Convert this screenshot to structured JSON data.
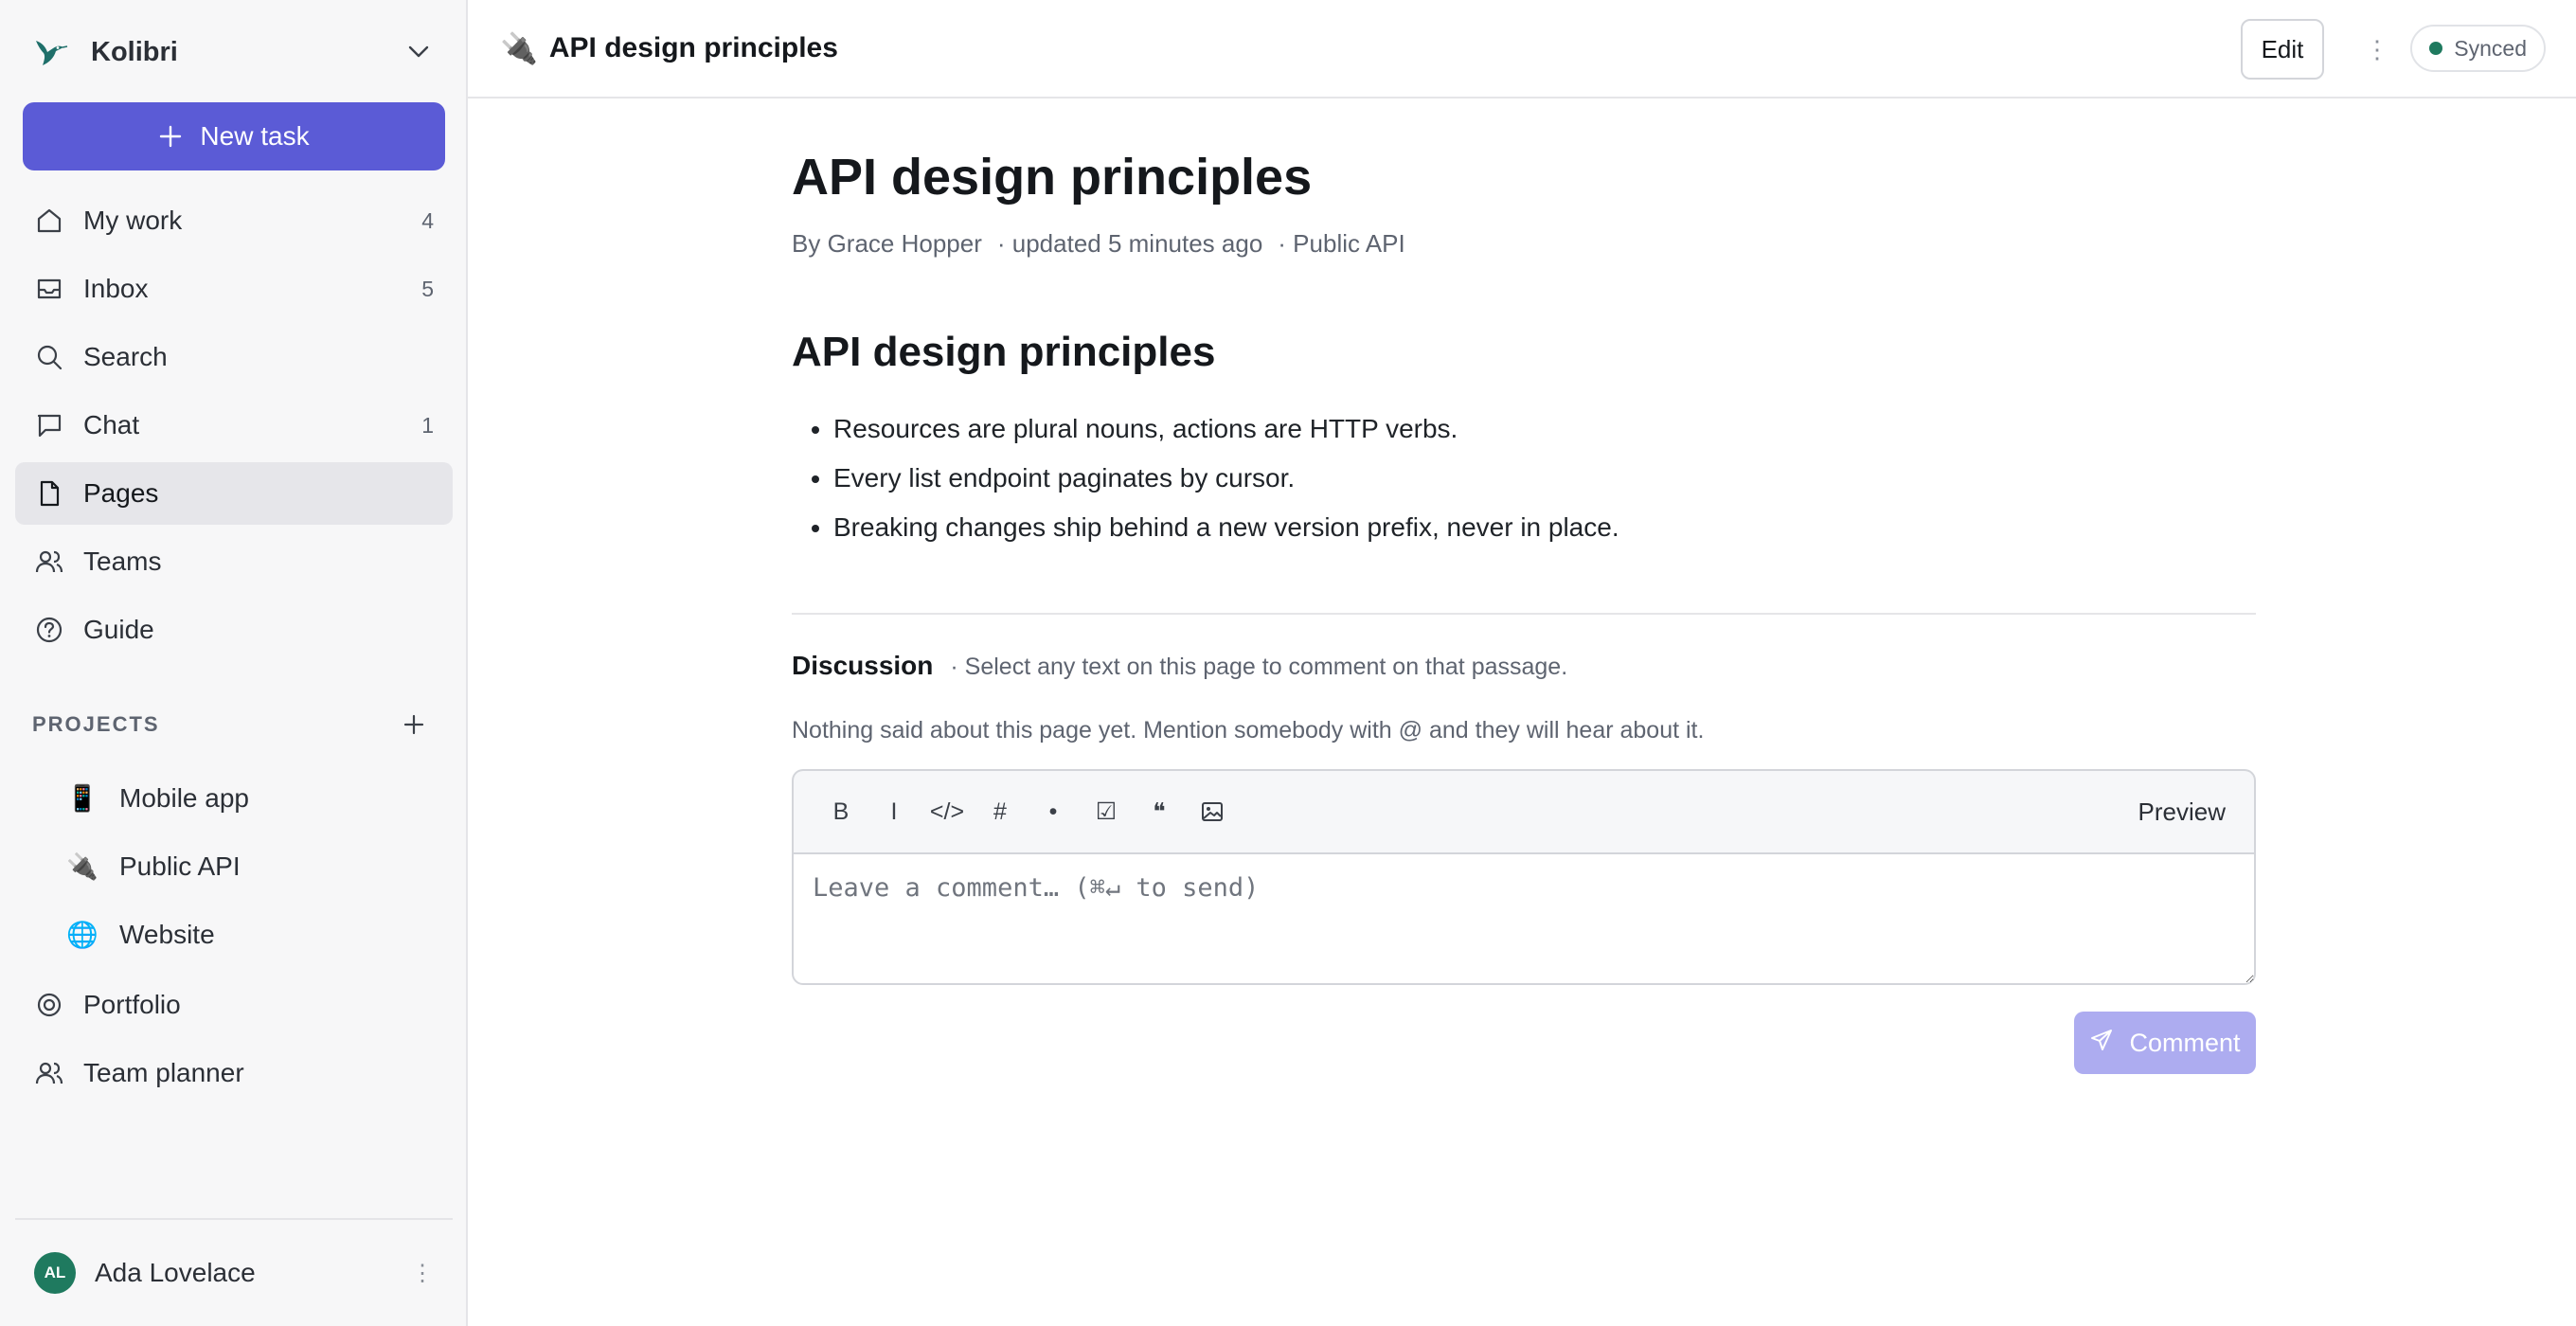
{
  "workspace": {
    "name": "Kolibri",
    "logo_icon": "hummingbird-icon"
  },
  "new_task_label": "New task",
  "nav": [
    {
      "label": "My work",
      "count": "4",
      "icon": "home-icon"
    },
    {
      "label": "Inbox",
      "count": "5",
      "icon": "inbox-icon"
    },
    {
      "label": "Search",
      "count": "",
      "icon": "search-icon"
    },
    {
      "label": "Chat",
      "count": "1",
      "icon": "chat-icon"
    },
    {
      "label": "Pages",
      "count": "",
      "icon": "page-icon",
      "active": true
    },
    {
      "label": "Teams",
      "count": "",
      "icon": "users-icon"
    },
    {
      "label": "Guide",
      "count": "",
      "icon": "help-icon"
    }
  ],
  "projects": {
    "heading": "PROJECTS",
    "items": [
      {
        "emoji": "📱",
        "label": "Mobile app"
      },
      {
        "emoji": "🔌",
        "label": "Public API"
      },
      {
        "emoji": "🌐",
        "label": "Website"
      }
    ]
  },
  "extra_nav": [
    {
      "label": "Portfolio",
      "icon": "target-icon"
    },
    {
      "label": "Team planner",
      "icon": "users-icon"
    }
  ],
  "user": {
    "initials": "AL",
    "name": "Ada Lovelace",
    "avatar_color": "#1f7a5f"
  },
  "topbar": {
    "emoji": "🔌",
    "title": "API design principles",
    "edit_label": "Edit",
    "more": "⋮",
    "sync_status": "Synced"
  },
  "page": {
    "title": "API design principles",
    "byline": {
      "author": "By Grace Hopper",
      "updated": "· updated 5 minutes ago",
      "project": "· Public API"
    },
    "heading": "API design principles",
    "bullets": [
      "Resources are plural nouns, actions are HTTP verbs.",
      "Every list endpoint paginates by cursor.",
      "Breaking changes ship behind a new version prefix, never in place."
    ]
  },
  "discussion": {
    "title": "Discussion",
    "hint": "· Select any text on this page to comment on that passage.",
    "empty": "Nothing said about this page yet. Mention somebody with @ and they will hear about it.",
    "toolbar": {
      "bold": "B",
      "italic": "I",
      "code": "</>",
      "heading": "#",
      "bullet": "•",
      "checkbox": "☑",
      "quote": "❝",
      "preview": "Preview"
    },
    "placeholder": "Leave a comment… (⌘↵ to send)",
    "submit_label": "Comment"
  },
  "colors": {
    "accent": "#5b5bd6",
    "accent_disabled": "#adacf0",
    "status_green": "#1f7a5f"
  }
}
